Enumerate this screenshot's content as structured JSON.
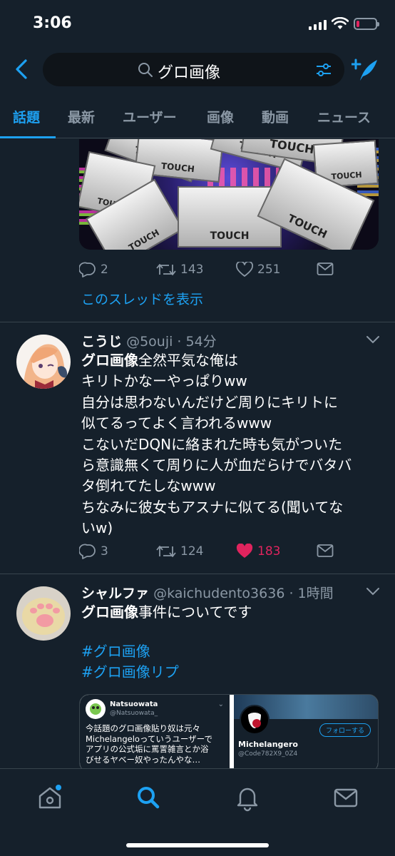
{
  "status_bar": {
    "time": "3:06",
    "battery_level": 0.15
  },
  "header": {
    "search_query": "グロ画像"
  },
  "tabs": [
    {
      "label": "話題"
    },
    {
      "label": "最新"
    },
    {
      "label": "ユーザー"
    },
    {
      "label": "画像"
    },
    {
      "label": "動画"
    },
    {
      "label": "ニュース"
    }
  ],
  "prev_tweet": {
    "media_text": "TOUCH",
    "replies": "2",
    "retweets": "143",
    "likes": "251",
    "thread_link": "このスレッドを表示"
  },
  "tweet1": {
    "name": "こうじ",
    "meta": "@5ouji · 54分",
    "highlight": "グロ画像",
    "text_line1": "全然平気な俺は",
    "text_rest": [
      "キリトかなーやっぱりww",
      "自分は思わないんだけど周りにキリトに",
      "似てるってよく言われるwww",
      "こないだDQNに絡まれた時も気がついた",
      "ら意識無くて周りに人が血だらけでバタバ",
      "タ倒れてたしなwww",
      "ちなみに彼女もアスナに似てる(聞いてな",
      "いw)"
    ],
    "replies": "3",
    "retweets": "124",
    "likes": "183"
  },
  "tweet2": {
    "name": "シャルファ",
    "meta": "@kaichudento3636 · 1時間",
    "highlight": "グロ画像",
    "text": "事件についてです",
    "hashtags": [
      "#グロ画像",
      "#グロ画像リプ"
    ],
    "quote_left": {
      "name": "Natsuowata",
      "handle": "@Natsuowata_",
      "lines": [
        "今話題のグロ画像貼り奴は元々",
        "Michelangeloっていうユーザーで",
        "アプリの公式垢に罵詈雑言とか浴",
        "びせるヤベー奴やったんやな…"
      ]
    },
    "quote_right": {
      "name": "Michelangero",
      "handle": "@Code782X9_0Z4",
      "follow": "フォローする"
    }
  },
  "colors": {
    "accent": "#1da1f2",
    "like": "#e0245e",
    "bg": "#15202b",
    "muted": "#8b98a5"
  }
}
